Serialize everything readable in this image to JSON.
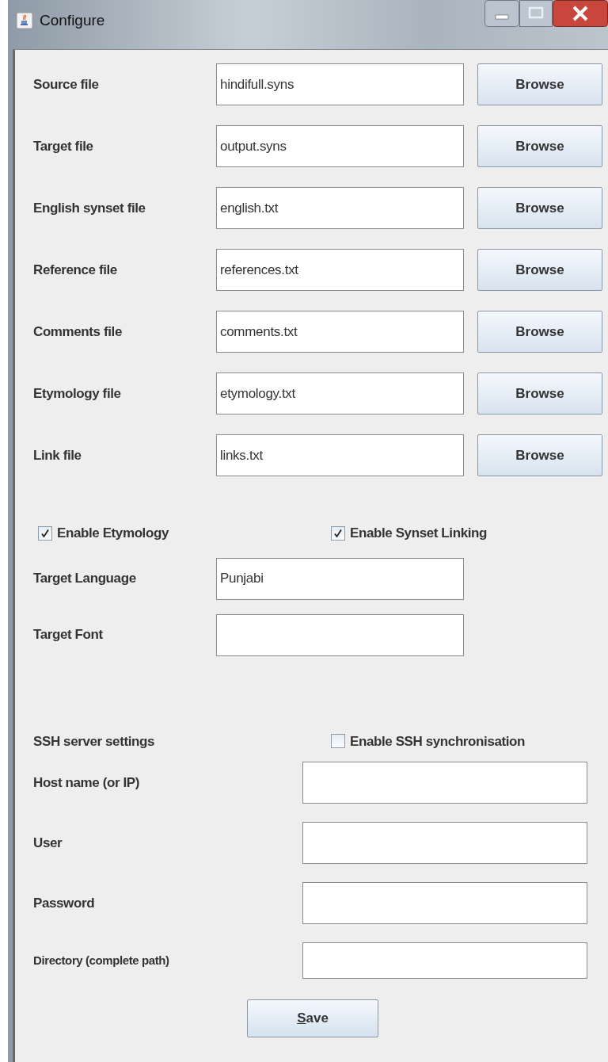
{
  "window": {
    "title": "Configure"
  },
  "file_rows": [
    {
      "label": "Source file",
      "value": "hindifull.syns",
      "button": "Browse"
    },
    {
      "label": "Target file",
      "value": "output.syns",
      "button": "Browse"
    },
    {
      "label": "English synset file",
      "value": "english.txt",
      "button": "Browse"
    },
    {
      "label": "Reference file",
      "value": "references.txt",
      "button": "Browse"
    },
    {
      "label": "Comments file",
      "value": "comments.txt",
      "button": "Browse"
    },
    {
      "label": "Etymology file",
      "value": "etymology.txt",
      "button": "Browse"
    },
    {
      "label": "Link file",
      "value": "links.txt",
      "button": "Browse"
    }
  ],
  "checkboxes": [
    {
      "label": "Enable Etymology",
      "checked": true
    },
    {
      "label": "Enable Synset Linking",
      "checked": true
    }
  ],
  "language_rows": [
    {
      "label": "Target Language",
      "value": "Punjabi"
    },
    {
      "label": "Target Font"
    }
  ],
  "ssh": {
    "heading": "SSH server settings",
    "checkbox": {
      "label": "Enable SSH synchronisation",
      "checked": false
    },
    "fields": [
      {
        "label": "Host name (or IP)",
        "kind": "normal"
      },
      {
        "label": "User",
        "kind": "normal"
      },
      {
        "label": "Password",
        "kind": "normal"
      },
      {
        "label": "Directory (complete path)",
        "kind": "compact"
      }
    ]
  },
  "save_button": {
    "label": "Save",
    "mnemonic": true
  }
}
